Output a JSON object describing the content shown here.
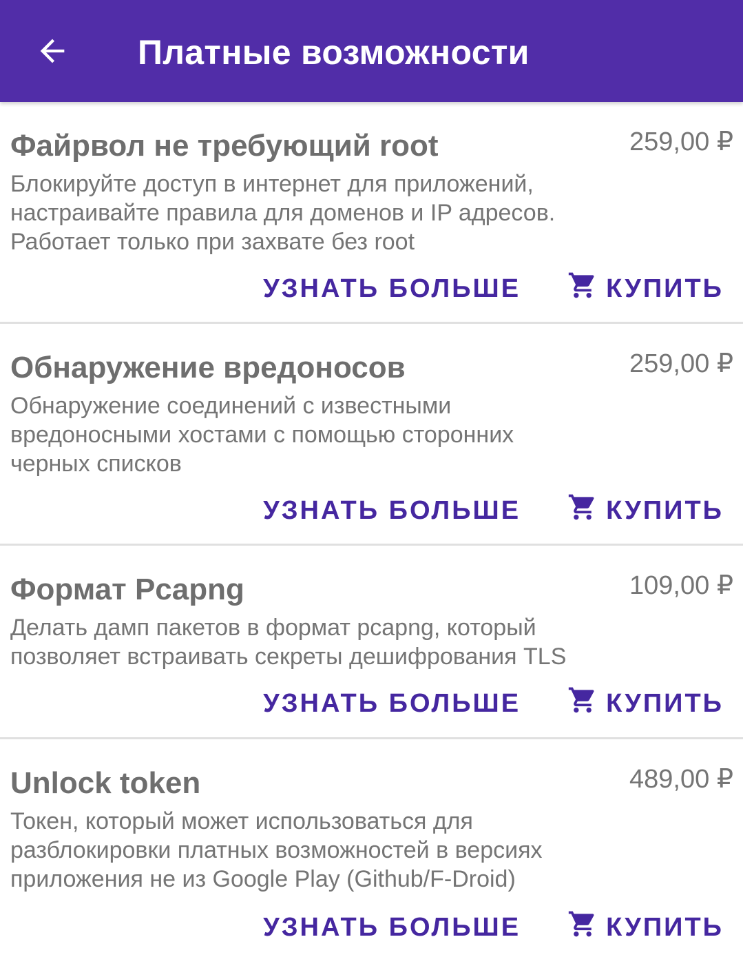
{
  "appbar": {
    "title": "Платные возможности",
    "back_icon": "arrow-back-icon",
    "background": "#512da8"
  },
  "accent_color": "#4527a0",
  "items": [
    {
      "title": "Файрвол не требующий root",
      "price": "259,00 ₽",
      "description_lines": [
        "Блокируйте доступ в интернет для приложений,",
        "настраивайте правила для доменов и IP адресов.",
        "Работает только при захвате без root"
      ],
      "more_label": "УЗНАТЬ БОЛЬШЕ",
      "buy_label": "КУПИТЬ",
      "buy_icon": "cart-icon"
    },
    {
      "title": "Обнаружение вредоносов",
      "price": "259,00 ₽",
      "description_lines": [
        "Обнаружение соединений с известными",
        "вредоносными хостами с помощью сторонних",
        "черных списков"
      ],
      "more_label": "УЗНАТЬ БОЛЬШЕ",
      "buy_label": "КУПИТЬ",
      "buy_icon": "cart-icon"
    },
    {
      "title": "Формат Pcapng",
      "price": "109,00 ₽",
      "description_lines": [
        "Делать дамп пакетов в формат pcapng, который",
        "позволяет встраивать секреты дешифрования TLS"
      ],
      "more_label": "УЗНАТЬ БОЛЬШЕ",
      "buy_label": "КУПИТЬ",
      "buy_icon": "cart-icon"
    },
    {
      "title": "Unlock token",
      "price": "489,00 ₽",
      "description_lines": [
        "Токен, который может использоваться для",
        "разблокировки платных возможностей в версиях",
        "приложения не из Google Play (Github/F-Droid)"
      ],
      "more_label": "УЗНАТЬ БОЛЬШЕ",
      "buy_label": "КУПИТЬ",
      "buy_icon": "cart-icon"
    }
  ]
}
